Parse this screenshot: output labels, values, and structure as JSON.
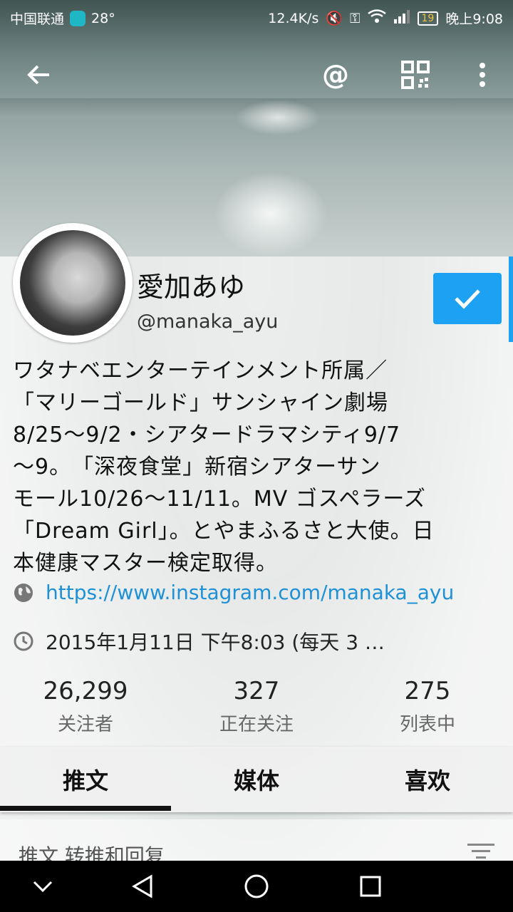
{
  "status_bar": {
    "carrier": "中国联通",
    "temperature": "28°",
    "net_speed": "12.4K/s",
    "battery": "19",
    "time": "晚上9:08"
  },
  "app_bar": {
    "back_icon": "arrow-left",
    "mention_label": "@",
    "qr_icon": "qr-code",
    "more_icon": "more-vert"
  },
  "profile": {
    "name": "愛加あゆ",
    "handle": "@manaka_ayu",
    "bio": "ワタナベエンターテインメント所属／\n「マリーゴールド」サンシャイン劇場\n8/25〜9/2・シアタードラマシティ9/7\n〜9。　「深夜食堂」新宿シアターサン\nモール10/26〜11/11。MV ゴスペラーズ\n「Dream Girl」。とやまふるさと大使。日\n本健康マスター検定取得。",
    "website": "https://www.instagram.com/manaka_ayu",
    "joined": "2015年1月11日 下午8:03 (每天 3 …"
  },
  "stats": [
    {
      "value": "26,299",
      "label": "关注者"
    },
    {
      "value": "327",
      "label": "正在关注"
    },
    {
      "value": "275",
      "label": "列表中"
    }
  ],
  "tabs": [
    {
      "label": "推文",
      "active": true
    },
    {
      "label": "媒体",
      "active": false
    },
    {
      "label": "喜欢",
      "active": false
    }
  ],
  "filter": {
    "label": "推文  转推和回复"
  },
  "colors": {
    "accent": "#1da1f2",
    "link": "#1e90d6"
  }
}
